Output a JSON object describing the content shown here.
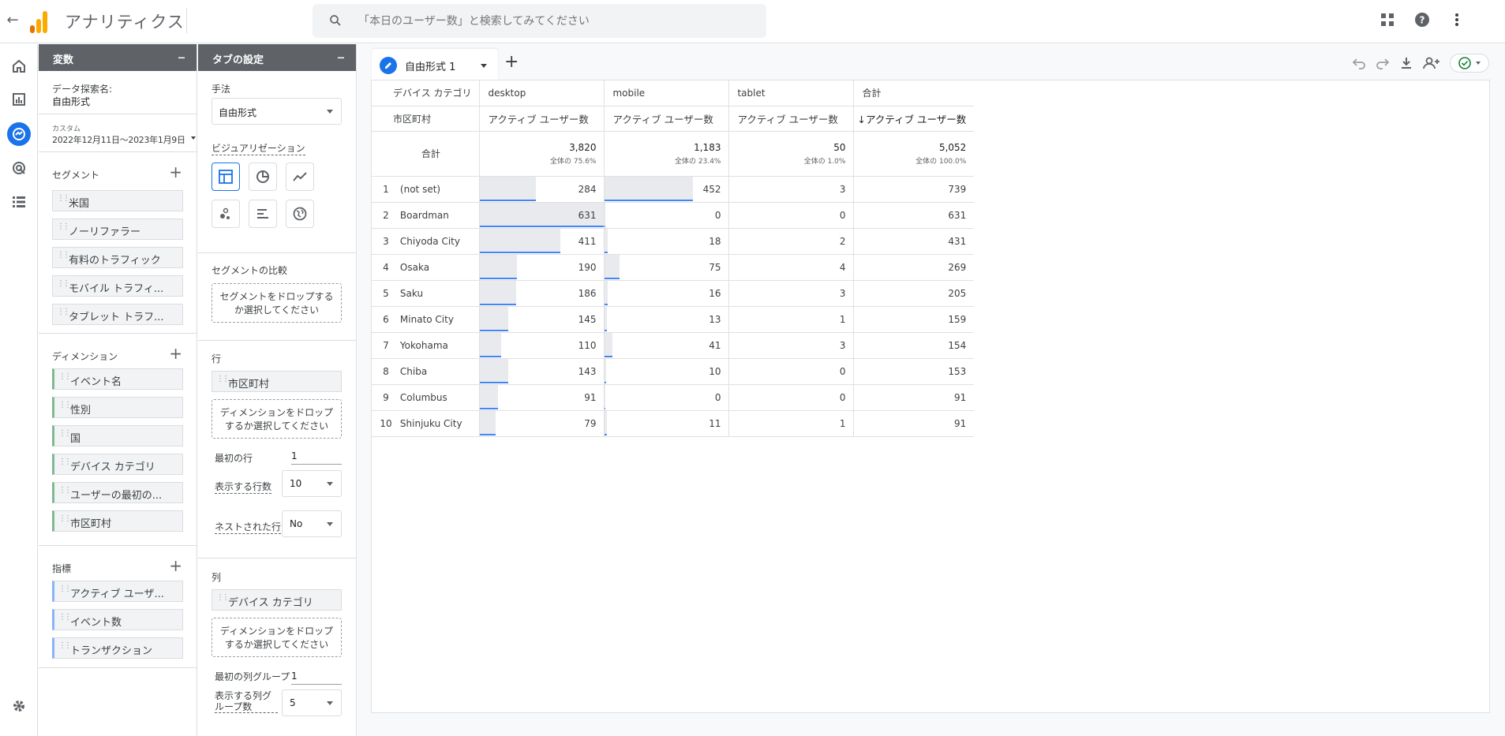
{
  "app": {
    "title": "アナリティクス",
    "back_icon": "arrow-back-icon"
  },
  "search": {
    "placeholder": "「本日のユーザー数」と検索してみてください"
  },
  "top_icons": [
    "apps-grid-icon",
    "help-icon",
    "more-vert-icon"
  ],
  "rail": [
    "home-icon",
    "reports-icon",
    "explore-icon",
    "advertising-icon",
    "configure-icon",
    "settings-icon"
  ],
  "variables": {
    "header": "変数",
    "name_label": "データ探索名:",
    "name_value": "自由形式",
    "date_small": "カスタム",
    "date_range": "2022年12月11日～2023年1月9日",
    "segments_title": "セグメント",
    "segments": [
      "米国",
      "ノーリファラー",
      "有料のトラフィック",
      "モバイル トラフィ...",
      "タブレット トラフ..."
    ],
    "dimensions_title": "ディメンション",
    "dimensions": [
      "イベント名",
      "性別",
      "国",
      "デバイス カテゴリ",
      "ユーザーの最初の...",
      "市区町村"
    ],
    "metrics_title": "指標",
    "metrics": [
      "アクティブ ユーザ...",
      "イベント数",
      "トランザクション"
    ]
  },
  "tab_settings": {
    "header": "タブの設定",
    "technique_label": "手法",
    "technique_value": "自由形式",
    "viz_label": "ビジュアリゼーション",
    "viz_icons": [
      "table-icon",
      "donut-chart-icon",
      "line-chart-icon",
      "scatter-icon",
      "bar-chart-icon",
      "geo-map-icon"
    ],
    "segment_compare_label": "セグメントの比較",
    "segment_drop": "セグメントをドロップするか選択してください",
    "rows_label": "行",
    "row_chip": "市区町村",
    "row_drop": "ディメンションをドロップするか選択してください",
    "start_row_label": "最初の行",
    "start_row_value": "1",
    "show_rows_label": "表示する行数",
    "show_rows_value": "10",
    "nested_label": "ネストされた行",
    "nested_value": "No",
    "cols_label": "列",
    "col_chip": "デバイス カテゴリ",
    "col_drop": "ディメンションをドロップするか選択してください",
    "start_col_label": "最初の列グループ",
    "start_col_value": "1",
    "show_cols_label": "表示する列グループ数",
    "show_cols_value": "5"
  },
  "canvas": {
    "tab_label": "自由形式 1",
    "add_tab": "+",
    "tools": [
      "undo-icon",
      "redo-icon",
      "download-icon",
      "share-icon",
      "check-status-icon"
    ]
  },
  "table": {
    "dim_header": "デバイス カテゴリ",
    "row_dim": "市区町村",
    "columns": [
      "desktop",
      "mobile",
      "tablet",
      "合計"
    ],
    "metric": "アクティブ ユーザー数",
    "metric_sorted": "↓アクティブ ユーザー数",
    "totals_label": "合計",
    "totals": [
      {
        "value": "3,820",
        "pct": "全体の 75.6%"
      },
      {
        "value": "1,183",
        "pct": "全体の 23.4%"
      },
      {
        "value": "50",
        "pct": "全体の 1.0%"
      },
      {
        "value": "5,052",
        "pct": "全体の 100.0%"
      }
    ],
    "rows": [
      {
        "idx": "1",
        "city": "(not set)",
        "desktop": "284",
        "mobile": "452",
        "tablet": "3",
        "total": "739"
      },
      {
        "idx": "2",
        "city": "Boardman",
        "desktop": "631",
        "mobile": "0",
        "tablet": "0",
        "total": "631"
      },
      {
        "idx": "3",
        "city": "Chiyoda City",
        "desktop": "411",
        "mobile": "18",
        "tablet": "2",
        "total": "431"
      },
      {
        "idx": "4",
        "city": "Osaka",
        "desktop": "190",
        "mobile": "75",
        "tablet": "4",
        "total": "269"
      },
      {
        "idx": "5",
        "city": "Saku",
        "desktop": "186",
        "mobile": "16",
        "tablet": "3",
        "total": "205"
      },
      {
        "idx": "6",
        "city": "Minato City",
        "desktop": "145",
        "mobile": "13",
        "tablet": "1",
        "total": "159"
      },
      {
        "idx": "7",
        "city": "Yokohama",
        "desktop": "110",
        "mobile": "41",
        "tablet": "3",
        "total": "154"
      },
      {
        "idx": "8",
        "city": "Chiba",
        "desktop": "143",
        "mobile": "10",
        "tablet": "0",
        "total": "153"
      },
      {
        "idx": "9",
        "city": "Columbus",
        "desktop": "91",
        "mobile": "0",
        "tablet": "0",
        "total": "91"
      },
      {
        "idx": "10",
        "city": "Shinjuku City",
        "desktop": "79",
        "mobile": "11",
        "tablet": "1",
        "total": "91"
      }
    ],
    "bar_max": 631
  },
  "colors": {
    "accent": "#1a73e8",
    "bar": "#e8eaed",
    "bar_line": "#4285f4",
    "header_dark": "#5f6368"
  }
}
